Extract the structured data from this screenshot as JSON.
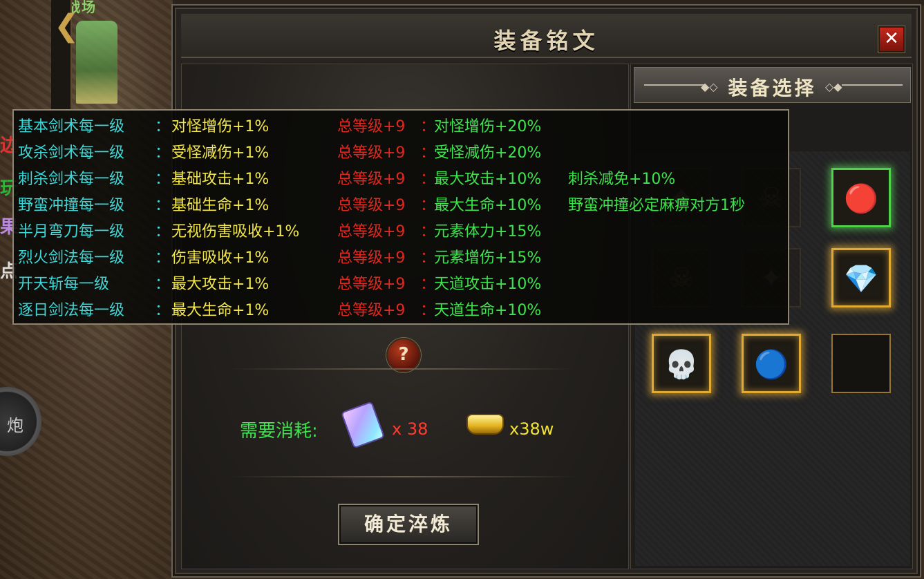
{
  "scene": {
    "map_title": "战场",
    "edge_glyphs": [
      "边",
      "玩",
      "果",
      "点"
    ],
    "round_button_label": "炮"
  },
  "window": {
    "title": "装备铭文",
    "close_label": "✕"
  },
  "equipment_panel": {
    "header": "装备选择",
    "slots": [
      {
        "state": "locked",
        "icon": "◆"
      },
      {
        "state": "locked",
        "icon": "☠"
      },
      {
        "state": "selected",
        "icon": "🔴"
      },
      {
        "state": "locked",
        "icon": "☠"
      },
      {
        "state": "locked",
        "icon": "✦"
      },
      {
        "state": "gold",
        "icon": "💎"
      },
      {
        "state": "gold",
        "icon": "💀"
      },
      {
        "state": "gold",
        "icon": "🔵"
      },
      {
        "state": "empty",
        "icon": ""
      }
    ]
  },
  "refine": {
    "help_label": "?",
    "cost_label": "需要消耗:",
    "crystal_count": "x 38",
    "gold_count": "x38w",
    "confirm_label": "确定淬炼"
  },
  "tooltip": {
    "rows": [
      {
        "skill": "基本剑术每一级",
        "colon": "：",
        "effect": "对怪增伤+1%",
        "total": "总等级+9",
        "colon2": "：",
        "bonus": "对怪增伤+20%",
        "extra": ""
      },
      {
        "skill": "攻杀剑术每一级",
        "colon": "：",
        "effect": "受怪减伤+1%",
        "total": "总等级+9",
        "colon2": "：",
        "bonus": "受怪减伤+20%",
        "extra": ""
      },
      {
        "skill": "刺杀剑术每一级",
        "colon": "：",
        "effect": "基础攻击+1%",
        "total": "总等级+9",
        "colon2": "：",
        "bonus": "最大攻击+10%",
        "extra": "刺杀减免+10%"
      },
      {
        "skill": "野蛮冲撞每一级",
        "colon": "：",
        "effect": "基础生命+1%",
        "total": "总等级+9",
        "colon2": "：",
        "bonus": "最大生命+10%",
        "extra": "野蛮冲撞必定麻痹对方1秒"
      },
      {
        "skill": "半月弯刀每一级",
        "colon": "：",
        "effect": "无视伤害吸收+1%",
        "total": "总等级+9",
        "colon2": "：",
        "bonus": "元素体力+15%",
        "extra": ""
      },
      {
        "skill": "烈火剑法每一级",
        "colon": "：",
        "effect": "伤害吸收+1%",
        "total": "总等级+9",
        "colon2": "：",
        "bonus": "元素增伤+15%",
        "extra": ""
      },
      {
        "skill": "开天斩每一级",
        "colon": "：",
        "effect": "最大攻击+1%",
        "total": "总等级+9",
        "colon2": "：",
        "bonus": "天道攻击+10%",
        "extra": ""
      },
      {
        "skill": "逐日剑法每一级",
        "colon": "：",
        "effect": "最大生命+1%",
        "total": "总等级+9",
        "colon2": "：",
        "bonus": "天道生命+10%",
        "extra": ""
      }
    ]
  }
}
